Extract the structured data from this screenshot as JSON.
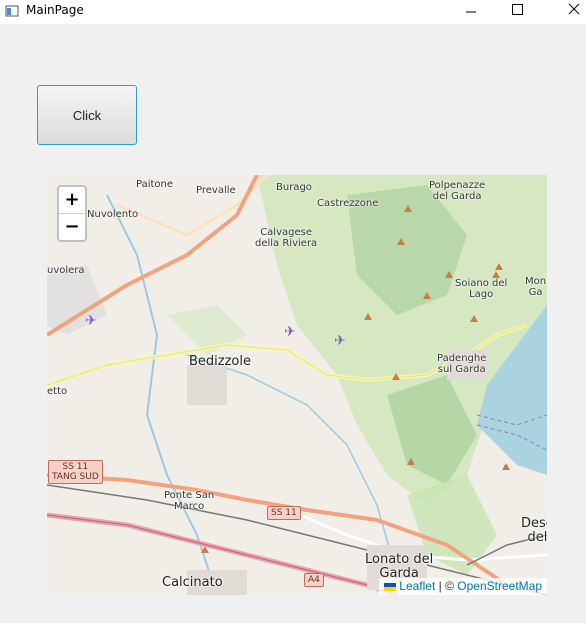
{
  "window": {
    "title": "MainPage"
  },
  "button": {
    "label": "Click"
  },
  "map": {
    "zoom_in": "+",
    "zoom_out": "−",
    "places": [
      "Paitone",
      "Prevalle",
      "Burago",
      "Polpenazze\ndel Garda",
      "Nuvolento",
      "Castrezzone",
      "Calvagese\ndella Riviera",
      "uvolera",
      "Soiano del\nLago",
      "Mon\nGa",
      "Bedizzole",
      "Padenghe\nsul Garda",
      "etto",
      "Ponte San\nMarco",
      "Calcinato",
      "Lonato del\nGarda",
      "Dese\ndel"
    ],
    "roads": [
      "SS 11\nTANG SUD",
      "SS 11",
      "A4"
    ],
    "attribution": {
      "leaflet": "Leaflet",
      "separator": " | © ",
      "osm": "OpenStreetMap"
    }
  }
}
